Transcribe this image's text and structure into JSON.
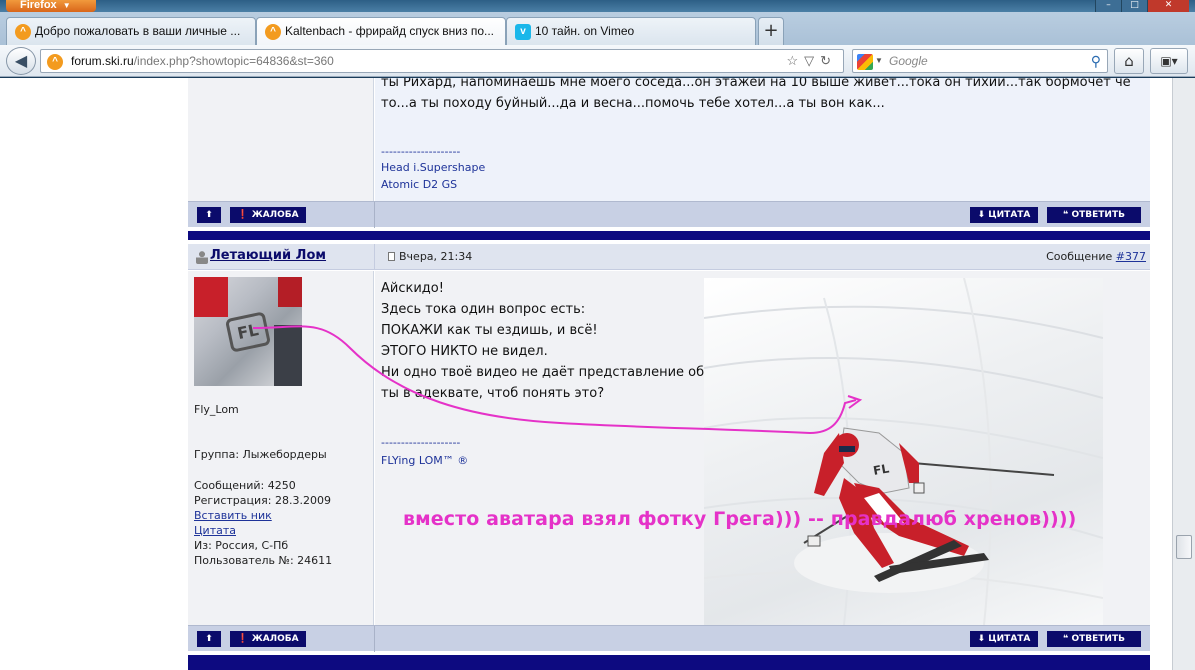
{
  "browser": {
    "app_button": "Firefox",
    "tabs": [
      {
        "label": "Добро пожаловать в ваши личные ...",
        "icon": "ski-favicon"
      },
      {
        "label": "Kaltenbach - фрирайд спуск вниз по...",
        "icon": "ski-favicon"
      },
      {
        "label": "10 тайн. on Vimeo",
        "icon": "vimeo-favicon"
      }
    ],
    "url_domain": "forum.ski.ru",
    "url_prefix": "",
    "url_rest": "/index.php?showtopic=64836&st=360",
    "search_placeholder": "Google"
  },
  "prev_post": {
    "text_lines": [
      "ты Рихард, напоминаешь мне моего соседа...он этажей на 10 выше живет...тока он тихий...так бормочет че",
      "то...а ты походу буйный...да и весна...помочь тебе хотел...а ты вон как..."
    ],
    "signature_separator": "--------------------",
    "signature_lines": [
      "Head i.Supershape",
      "Atomic D2 GS"
    ]
  },
  "action_bar": {
    "report_label": "ЖАЛОБА",
    "quote_label": "ЦИТАТА",
    "reply_label": "ОТВЕТИТЬ"
  },
  "post": {
    "author": "Летающий Лом",
    "date": "Вчера, 21:34",
    "message_prefix": "Сообщение ",
    "message_link": "#377",
    "user_title": "Fly_Lom",
    "group": "Группа: Лыжебордеры",
    "posts": "Сообщений: 4250",
    "registered": "Регистрация: 28.3.2009",
    "insert_nick": "Вставить ник",
    "quote_link": "Цитата",
    "location": "Из: Россия, С-Пб",
    "user_number": "Пользователь №: 24611",
    "text_lines": [
      "Айскидо!",
      "Здесь тока один вопрос есть:",
      "ПОКАЖИ как ты ездишь, и всё!",
      "ЭТОГО НИКТО не видел.",
      "Ни одно твоё видео не даёт представление об",
      "ты в адеквате, чтоб понять это?"
    ],
    "signature_separator": "--------------------",
    "signature": "FLYing LOM™ ®"
  },
  "annotation": "вместо аватара взял фотку Грега))) -- правдалюб хренов))))",
  "colors": {
    "forum_dark": "#0b0b6b",
    "annotation": "#e532c8",
    "link": "#1e3399"
  }
}
